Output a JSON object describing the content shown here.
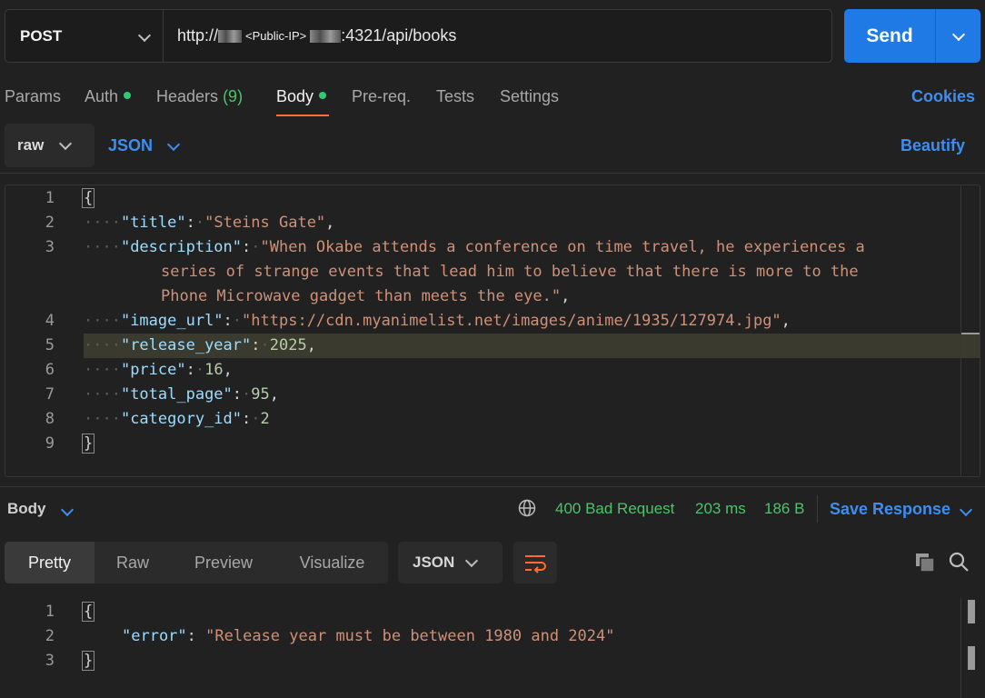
{
  "request": {
    "method": "POST",
    "url_prefix": "http://",
    "url_ip_label": "<Public-IP>",
    "url_suffix": ":4321/api/books",
    "send_label": "Send"
  },
  "tabs": {
    "params": "Params",
    "auth": "Auth",
    "headers": "Headers",
    "headers_count": "(9)",
    "body": "Body",
    "prereq": "Pre-req.",
    "tests": "Tests",
    "settings": "Settings",
    "cookies": "Cookies"
  },
  "body_options": {
    "mode": "raw",
    "language": "JSON",
    "beautify": "Beautify"
  },
  "request_body": {
    "line_numbers": [
      "1",
      "2",
      "3",
      "4",
      "5",
      "6",
      "7",
      "8",
      "9"
    ],
    "open": "{",
    "close": "}",
    "title_key": "\"title\"",
    "title_val": "\"Steins Gate\"",
    "desc_key": "\"description\"",
    "desc_val_1": "\"When Okabe attends a conference on time travel, he experiences a",
    "desc_val_2": "series of strange events that lead him to believe that there is more to the",
    "desc_val_3": "Phone Microwave gadget than meets the eye.\"",
    "image_key": "\"image_url\"",
    "image_val": "\"https://cdn.myanimelist.net/images/anime/1935/127974.jpg\"",
    "year_key": "\"release_year\"",
    "year_val": "2025",
    "price_key": "\"price\"",
    "price_val": "16",
    "pages_key": "\"total_page\"",
    "pages_val": "95",
    "cat_key": "\"category_id\"",
    "cat_val": "2"
  },
  "response": {
    "section_label": "Body",
    "status": "400 Bad Request",
    "time": "203 ms",
    "size": "186 B",
    "save_label": "Save Response",
    "view_tabs": [
      "Pretty",
      "Raw",
      "Preview",
      "Visualize"
    ],
    "format": "JSON",
    "line_numbers": [
      "1",
      "2",
      "3"
    ],
    "open": "{",
    "close": "}",
    "error_key": "\"error\"",
    "error_val": "\"Release year must be between 1980 and 2024\""
  },
  "colors": {
    "accent": "#ff6c37",
    "primary": "#1f7ae6",
    "link": "#3d8ef0",
    "success": "#4cc36a"
  }
}
